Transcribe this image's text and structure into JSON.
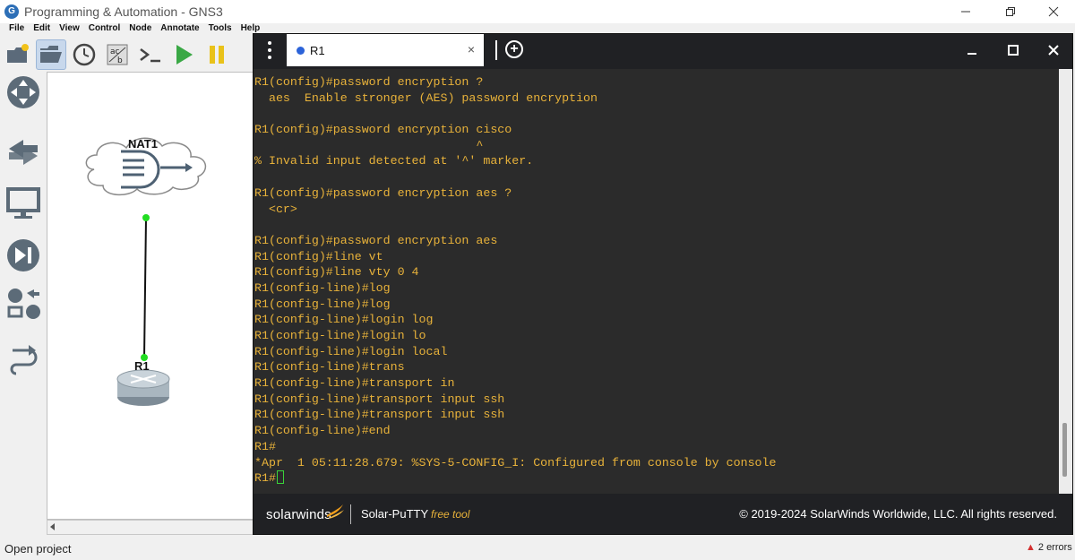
{
  "gns": {
    "title": "Programming & Automation - GNS3",
    "logo_letter": "G",
    "menu": [
      "File",
      "Edit",
      "View",
      "Control",
      "Node",
      "Annotate",
      "Tools",
      "Help"
    ],
    "status": "Open project",
    "errors": "2 errors"
  },
  "canvas": {
    "node1": "NAT1",
    "node2": "R1"
  },
  "putty": {
    "tab_label": "R1",
    "tab_close": "×",
    "new_tab": "+",
    "lines": [
      "R1(config)#password encryption ?",
      "  aes  Enable stronger (AES) password encryption",
      "",
      "R1(config)#password encryption cisco",
      "                               ^",
      "% Invalid input detected at '^' marker.",
      "",
      "R1(config)#password encryption aes ?",
      "  <cr>",
      "",
      "R1(config)#password encryption aes",
      "R1(config)#line vt",
      "R1(config)#line vty 0 4",
      "R1(config-line)#log",
      "R1(config-line)#log",
      "R1(config-line)#login log",
      "R1(config-line)#login lo",
      "R1(config-line)#login local",
      "R1(config-line)#trans",
      "R1(config-line)#transport in",
      "R1(config-line)#transport input ssh",
      "R1(config-line)#transport input ssh",
      "R1(config-line)#end",
      "R1#",
      "*Apr  1 05:11:28.679: %SYS-5-CONFIG_I: Configured from console by console"
    ],
    "prompt": "R1#",
    "footer": {
      "brand": "solarwinds",
      "product": "Solar-PuTTY",
      "free": "free tool",
      "copyright": "© 2019-2024 SolarWinds Worldwide, LLC. All rights reserved."
    }
  },
  "colors": {
    "terminal_text": "#e8b23a",
    "terminal_bg": "#2b2b2b",
    "cursor": "#3ad43a",
    "link_dot": "#22dd22",
    "tab_dot": "#2b63d9"
  }
}
